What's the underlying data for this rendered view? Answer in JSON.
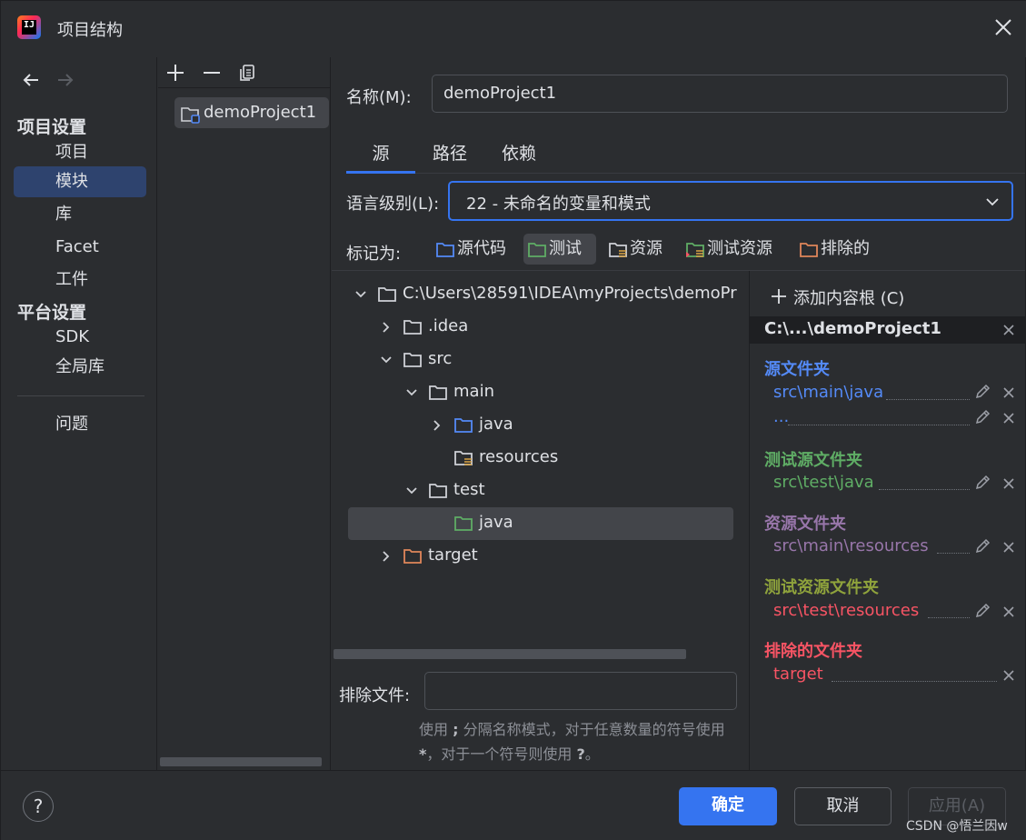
{
  "window": {
    "title": "项目结构"
  },
  "nav": {
    "back": "back-arrow",
    "forward": "forward-arrow",
    "project_settings_header": "项目设置",
    "project_items": [
      "项目",
      "模块",
      "库",
      "Facet",
      "工件"
    ],
    "platform_settings_header": "平台设置",
    "platform_items": [
      "SDK",
      "全局库"
    ],
    "problems": "问题"
  },
  "modules": {
    "items": [
      "demoProject1"
    ]
  },
  "main": {
    "name_label": "名称(M):",
    "name_value": "demoProject1",
    "tabs": [
      "源",
      "路径",
      "依赖"
    ],
    "language_level_label": "语言级别(L):",
    "language_level_value": "22 - 未命名的变量和模式",
    "mark_as_label": "标记为:",
    "mark_buttons": [
      "源代码",
      "测试",
      "资源",
      "测试资源",
      "排除的"
    ]
  },
  "tree": {
    "rows": [
      "C:\\Users\\28591\\IDEA\\myProjects\\demoPr",
      ".idea",
      "src",
      "main",
      "java",
      "resources",
      "test",
      "java",
      "target"
    ]
  },
  "exclude": {
    "label": "排除文件:",
    "value": "",
    "hint_part1": "使用 ",
    "hint_sym1": ";",
    "hint_part2": " 分隔名称模式，对于任意数量的符号使用 ",
    "hint_sym2": "*",
    "hint_part3": "，对于一个符号则使用 ",
    "hint_sym3": "?",
    "hint_part4": "。"
  },
  "roots": {
    "add_label": "添加内容根 (C)",
    "root_path": "C:\\...\\demoProject1",
    "source_title": "源文件夹",
    "source_entries": [
      "src\\main\\java",
      "..."
    ],
    "test_title": "测试源文件夹",
    "test_entries": [
      "src\\test\\java"
    ],
    "resource_title": "资源文件夹",
    "resource_entries": [
      "src\\main\\resources"
    ],
    "test_resource_title": "测试资源文件夹",
    "test_resource_entries": [
      "src\\test\\resources"
    ],
    "excluded_title": "排除的文件夹",
    "excluded_entries": [
      "target"
    ]
  },
  "footer": {
    "help": "?",
    "ok": "确定",
    "cancel": "取消",
    "apply": "应用(A)",
    "watermark": "CSDN @悟兰因w"
  },
  "colors": {
    "accent": "#3574f0",
    "source": "#548af7",
    "test": "#5fad65",
    "resource": "#9876aa",
    "test_resource": "#8fa33c",
    "excluded": "#f75464",
    "selection": "#2e436e"
  }
}
